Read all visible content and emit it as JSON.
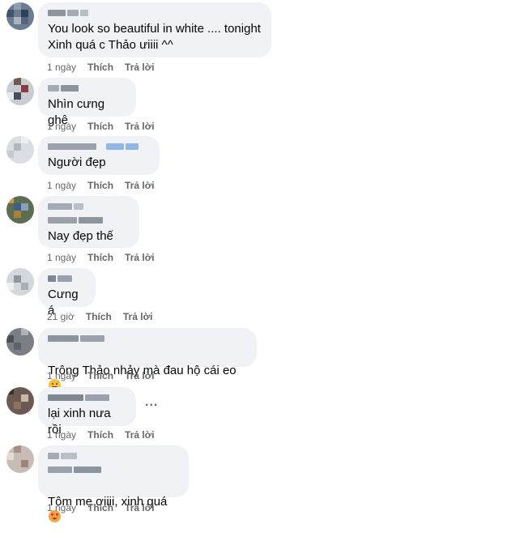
{
  "comments": [
    {
      "text": "You look so beautiful in white .... tonight\nXinh quá c Thảo ưiiii ^^",
      "time": "1 ngày",
      "like": "Thích",
      "reply": "Trả lời"
    },
    {
      "text": "Nhìn cưng ghê",
      "time": "1 ngày",
      "like": "Thích",
      "reply": "Trả lời"
    },
    {
      "text": "Người đẹp",
      "time": "1 ngày",
      "like": "Thích",
      "reply": "Trả lời"
    },
    {
      "text": "Nay đẹp thế",
      "time": "1 ngày",
      "like": "Thích",
      "reply": "Trả lời"
    },
    {
      "text": "Cưng á",
      "time": "21 giờ",
      "like": "Thích",
      "reply": "Trả lời"
    },
    {
      "text": "Trông Thảo nhảy mà đau hộ cái eo",
      "emoji": "grinning-sweat-emoji",
      "time": "1 ngày",
      "like": "Thích",
      "reply": "Trả lời"
    },
    {
      "text": "lại xinh nưa rồi",
      "time": "1 ngày",
      "like": "Thích",
      "reply": "Trả lời",
      "more": "..."
    },
    {
      "text": "Tôm mẹ ơiiii, xinh quá",
      "emoji": "heart-eyes-emoji",
      "time": "1 ngày",
      "like": "Thích",
      "reply": "Trả lời"
    }
  ],
  "colors": {
    "bubble": "#f0f2f5",
    "text": "#050505",
    "meta": "#65676b"
  }
}
